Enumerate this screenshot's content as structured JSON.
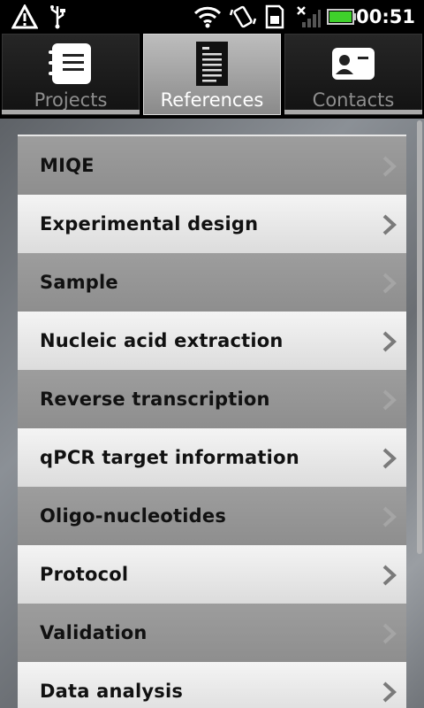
{
  "status_bar": {
    "time": "00:51",
    "icons": [
      "warning-icon",
      "usb-icon",
      "wifi-icon",
      "vibrate-icon",
      "sim-icon",
      "signal-icon",
      "battery-icon"
    ]
  },
  "tabs": [
    {
      "label": "Projects",
      "icon": "notebook-icon",
      "active": false
    },
    {
      "label": "References",
      "icon": "document-icon",
      "active": true
    },
    {
      "label": "Contacts",
      "icon": "contact-card-icon",
      "active": false
    }
  ],
  "list": {
    "items": [
      {
        "label": "MIQE"
      },
      {
        "label": "Experimental design"
      },
      {
        "label": "Sample"
      },
      {
        "label": "Nucleic acid extraction"
      },
      {
        "label": "Reverse transcription"
      },
      {
        "label": "qPCR target information"
      },
      {
        "label": "Oligo-nucleotides"
      },
      {
        "label": "Protocol"
      },
      {
        "label": "Validation"
      },
      {
        "label": "Data analysis"
      }
    ]
  }
}
